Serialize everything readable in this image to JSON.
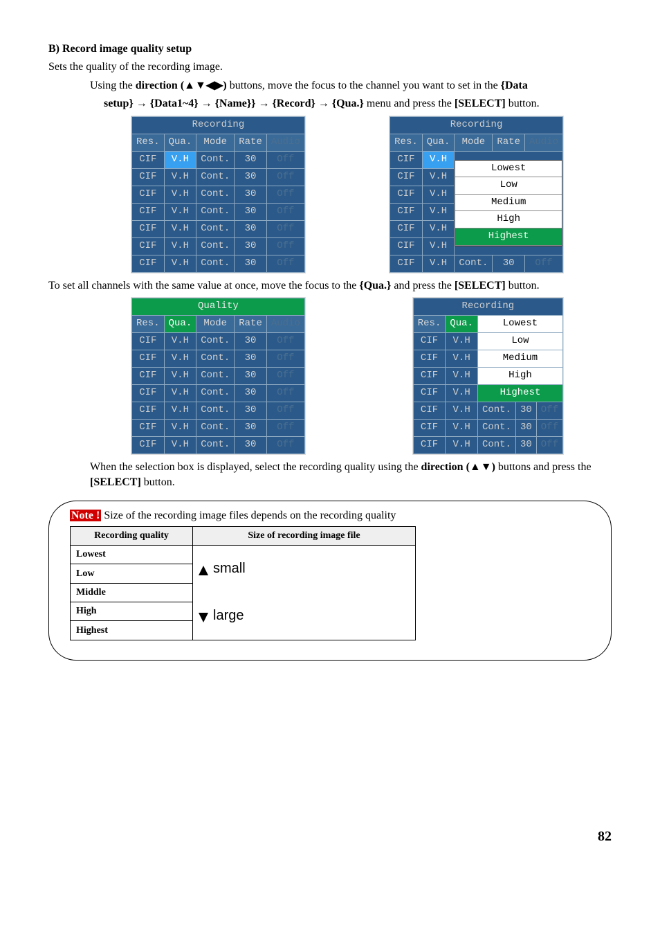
{
  "section": {
    "heading": "B)  Record image quality setup",
    "intro": "Sets the quality of the recording image.",
    "line1_a": "Using the ",
    "line1_b": "direction (▲▼◀▶)",
    "line1_c": " buttons, move the focus to the channel you want to set in the ",
    "line1_d": "{Data",
    "line2_a": "setup}",
    "arrow": " → ",
    "line2_b": "{Data1~4}",
    "line2_c": "{Name}}",
    "line2_d": "{Record}",
    "line2_e": "{Qua.}",
    "line2_f": " menu and press the ",
    "line2_g": "[SELECT]",
    "line2_h": " button."
  },
  "tbl1": {
    "title": "Recording",
    "headers": [
      "Res.",
      "Qua.",
      "Mode",
      "Rate",
      "Audio"
    ],
    "rows": [
      [
        "CIF",
        "V.H",
        "Cont.",
        "30",
        "Off"
      ],
      [
        "CIF",
        "V.H",
        "Cont.",
        "30",
        "Off"
      ],
      [
        "CIF",
        "V.H",
        "Cont.",
        "30",
        "Off"
      ],
      [
        "CIF",
        "V.H",
        "Cont.",
        "30",
        "Off"
      ],
      [
        "CIF",
        "V.H",
        "Cont.",
        "30",
        "Off"
      ],
      [
        "CIF",
        "V.H",
        "Cont.",
        "30",
        "Off"
      ],
      [
        "CIF",
        "V.H",
        "Cont.",
        "30",
        "Off"
      ]
    ]
  },
  "tbl2": {
    "title": "Recording",
    "headers": [
      "Res.",
      "Qua.",
      "Mode",
      "Rate",
      "Audio"
    ],
    "rowsTop": [
      [
        "CIF",
        "V.H"
      ],
      [
        "CIF",
        "V.H"
      ],
      [
        "CIF",
        "V.H"
      ],
      [
        "CIF",
        "V.H"
      ],
      [
        "CIF",
        "V.H"
      ],
      [
        "CIF",
        "V.H"
      ]
    ],
    "lastRow": [
      "CIF",
      "V.H",
      "Cont.",
      "30",
      "Off"
    ],
    "dropdown": [
      "Lowest",
      "Low",
      "Medium",
      "High",
      "Highest"
    ]
  },
  "midpara_a": "To set all channels with the same value at once, move the focus to the ",
  "midpara_b": "{Qua.}",
  "midpara_c": " and press the ",
  "midpara_d": "[SELECT]",
  "midpara_e": " button.",
  "tbl3": {
    "title": "Quality",
    "headers": [
      "Res.",
      "Qua.",
      "Mode",
      "Rate",
      "Audio"
    ],
    "rows": [
      [
        "CIF",
        "V.H",
        "Cont.",
        "30",
        "Off"
      ],
      [
        "CIF",
        "V.H",
        "Cont.",
        "30",
        "Off"
      ],
      [
        "CIF",
        "V.H",
        "Cont.",
        "30",
        "Off"
      ],
      [
        "CIF",
        "V.H",
        "Cont.",
        "30",
        "Off"
      ],
      [
        "CIF",
        "V.H",
        "Cont.",
        "30",
        "Off"
      ],
      [
        "CIF",
        "V.H",
        "Cont.",
        "30",
        "Off"
      ],
      [
        "CIF",
        "V.H",
        "Cont.",
        "30",
        "Off"
      ]
    ]
  },
  "tbl4": {
    "title": "Recording",
    "headers": [
      "Res.",
      "Qua."
    ],
    "wide": [
      "Lowest",
      "Low",
      "Medium",
      "High",
      "Highest"
    ],
    "rows": [
      [
        "CIF",
        "V.H"
      ],
      [
        "CIF",
        "V.H"
      ],
      [
        "CIF",
        "V.H"
      ],
      [
        "CIF",
        "V.H"
      ]
    ],
    "bottom": [
      [
        "CIF",
        "V.H",
        "Cont.",
        "30",
        "Off"
      ],
      [
        "CIF",
        "V.H",
        "Cont.",
        "30",
        "Off"
      ],
      [
        "CIF",
        "V.H",
        "Cont.",
        "30",
        "Off"
      ]
    ]
  },
  "afterpara_a": "When the selection box is displayed, select the recording quality using the ",
  "afterpara_b": "direction (▲▼)",
  "afterpara_c": " buttons and press the ",
  "afterpara_d": "[SELECT]",
  "afterpara_e": " button.",
  "note": {
    "badge": "Note !",
    "text": " Size of the recording image files depends on the recording quality",
    "th1": "Recording quality",
    "th2": "Size of recording image file",
    "rows": [
      "Lowest",
      "Low",
      "Middle",
      "High",
      "Highest"
    ],
    "small": "small",
    "large": "large"
  },
  "pagenum": "82"
}
